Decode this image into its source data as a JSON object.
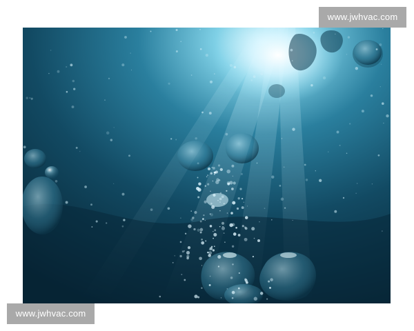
{
  "image": {
    "subject": "underwater-bubbles-photo",
    "colors": {
      "deep": "#06202e",
      "mid": "#0f4a63",
      "light": "#3f98b4",
      "glow": "#e9fbff"
    }
  },
  "watermarks": {
    "top_right": "www.jwhvac.com",
    "bottom_left": "www.jwhvac.com",
    "background_color": "#a9a9a9",
    "text_color": "#ffffff"
  }
}
